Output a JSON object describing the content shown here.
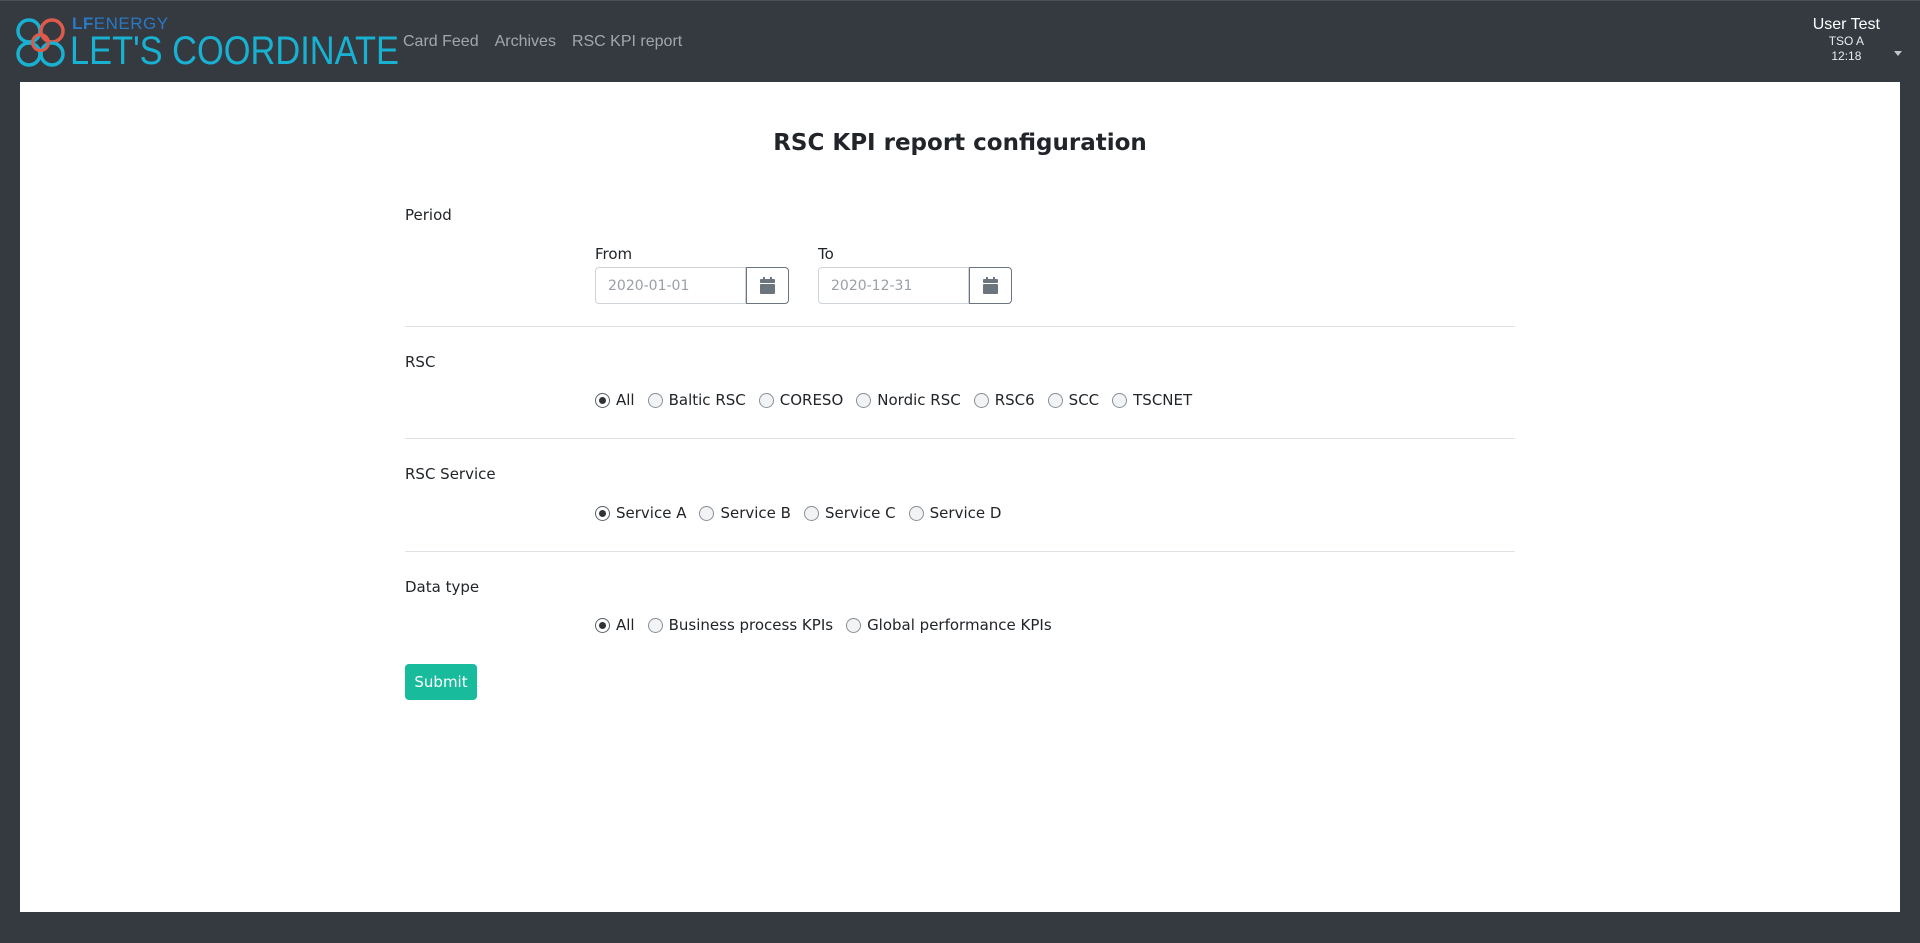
{
  "header": {
    "logo": {
      "lf": "LF",
      "energy": "ENERGY",
      "name": "LET'S COORDINATE"
    },
    "nav": [
      "Card Feed",
      "Archives",
      "RSC KPI report"
    ],
    "user": {
      "name": "User Test",
      "entity": "TSO A",
      "time": "12:18"
    }
  },
  "form": {
    "title": "RSC KPI report configuration",
    "period": {
      "label": "Period",
      "from_label": "From",
      "from_placeholder": "2020-01-01",
      "to_label": "To",
      "to_placeholder": "2020-12-31"
    },
    "rsc": {
      "label": "RSC",
      "options": [
        "All",
        "Baltic RSC",
        "CORESO",
        "Nordic RSC",
        "RSC6",
        "SCC",
        "TSCNET"
      ],
      "selected": "All"
    },
    "service": {
      "label": "RSC Service",
      "options": [
        "Service A",
        "Service B",
        "Service C",
        "Service D"
      ],
      "selected": "Service A"
    },
    "data_type": {
      "label": "Data type",
      "options": [
        "All",
        "Business process KPIs",
        "Global performance KPIs"
      ],
      "selected": "All"
    },
    "submit_label": "Submit"
  },
  "colors": {
    "navbar": "#343a40",
    "brand": "#19b1d1",
    "submit": "#18bc9c"
  }
}
